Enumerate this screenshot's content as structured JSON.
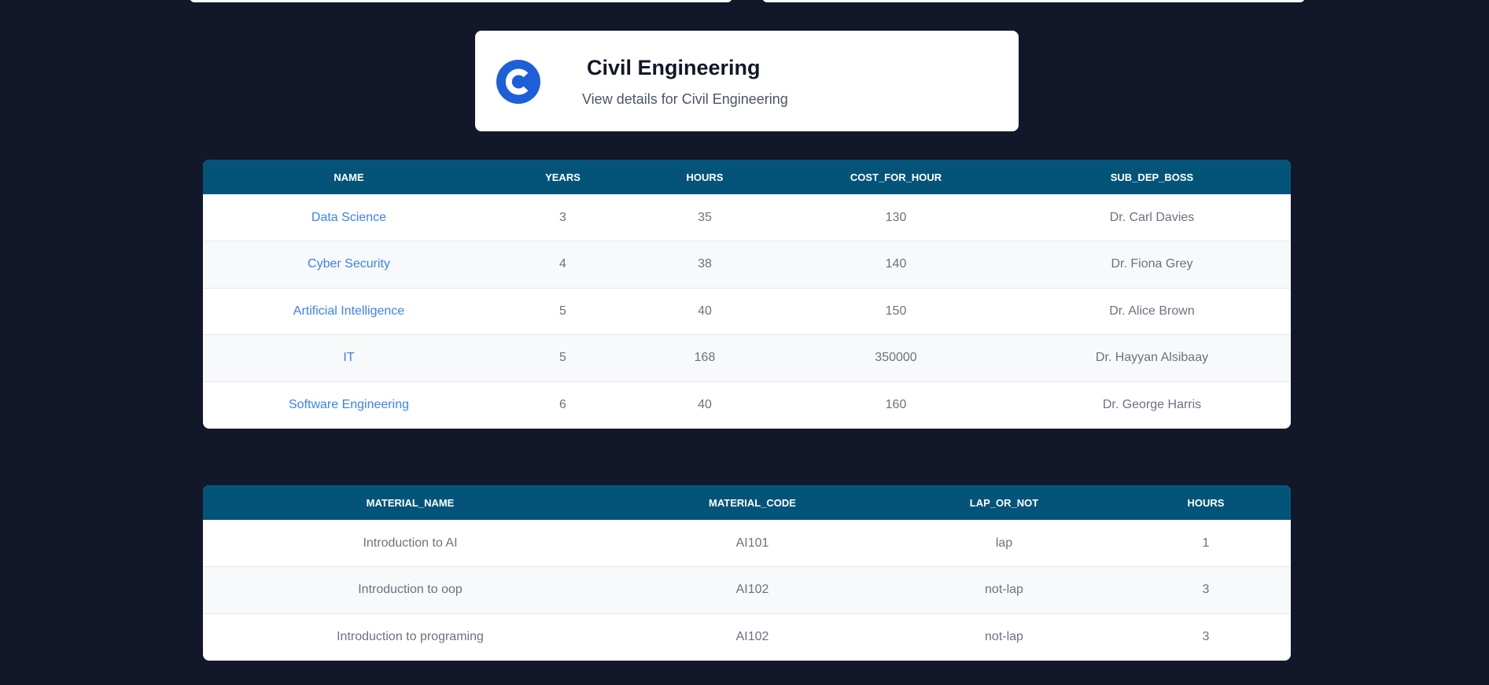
{
  "department": {
    "title": "Civil Engineering",
    "subtitle": "View details for Civil Engineering",
    "icon": "letter-c-icon",
    "icon_color": "#1d5fd6"
  },
  "subdepartments": {
    "headers": [
      "NAME",
      "YEARS",
      "HOURS",
      "COST_FOR_HOUR",
      "SUB_DEP_BOSS"
    ],
    "rows": [
      {
        "name": "Data Science",
        "years": "3",
        "hours": "35",
        "cost": "130",
        "boss": "Dr. Carl Davies"
      },
      {
        "name": "Cyber Security",
        "years": "4",
        "hours": "38",
        "cost": "140",
        "boss": "Dr. Fiona Grey"
      },
      {
        "name": "Artificial Intelligence",
        "years": "5",
        "hours": "40",
        "cost": "150",
        "boss": "Dr. Alice Brown"
      },
      {
        "name": "IT",
        "years": "5",
        "hours": "168",
        "cost": "350000",
        "boss": "Dr. Hayyan Alsibaay"
      },
      {
        "name": "Software Engineering",
        "years": "6",
        "hours": "40",
        "cost": "160",
        "boss": "Dr. George Harris"
      }
    ]
  },
  "materials": {
    "headers": [
      "MATERIAL_NAME",
      "MATERIAL_CODE",
      "LAP_OR_NOT",
      "HOURS"
    ],
    "rows": [
      {
        "name": "Introduction to AI",
        "code": "AI101",
        "lap": "lap",
        "hours": "1"
      },
      {
        "name": "Introduction to oop",
        "code": "AI102",
        "lap": "not-lap",
        "hours": "3"
      },
      {
        "name": "Introduction to programing",
        "code": "AI102",
        "lap": "not-lap",
        "hours": "3"
      }
    ]
  },
  "colors": {
    "background": "#121829",
    "table_header": "#04547a",
    "link": "#3b82f6"
  }
}
